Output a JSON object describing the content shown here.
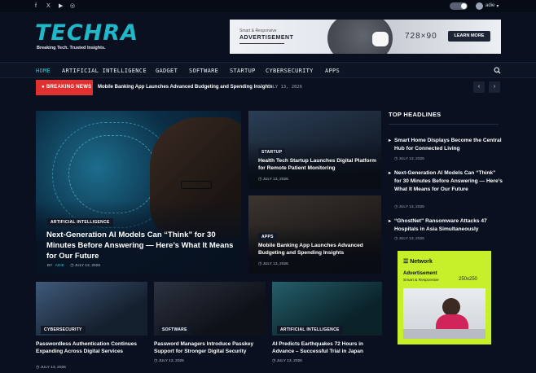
{
  "topbar": {
    "social_icons": [
      "facebook-icon",
      "x-icon",
      "youtube-icon",
      "instagram-icon"
    ],
    "social_glyphs": [
      "f",
      "X",
      "▶",
      "◎"
    ],
    "user_name": "adie",
    "user_caret": "▾"
  },
  "header": {
    "logo": "TECHRA",
    "tagline": "Breaking Tech. Trusted Insights.",
    "ad": {
      "small": "Smart & Responsive",
      "title": "ADVERTISEMENT",
      "size": "728×90",
      "button": "LEARN MORE"
    }
  },
  "nav": {
    "items": [
      "HOME",
      "ARTIFICIAL INTELLIGENCE",
      "GADGET",
      "SOFTWARE",
      "STARTUP",
      "CYBERSECURITY",
      "APPS"
    ],
    "active_index": 0
  },
  "breaking": {
    "label": "BREAKING NEWS",
    "headline": "Mobile Banking App Launches Advanced Budgeting and Spending Insights",
    "date": "JULY 13, 2026",
    "prev": "‹",
    "next": "›"
  },
  "featured": {
    "category": "ARTIFICIAL INTELLIGENCE",
    "title": "Next-Generation AI Models Can “Think” for 30 Minutes Before Answering — Here’s What It Means for Our Future",
    "by": "BY",
    "author": "ADIE",
    "date": "JULY 13, 2026"
  },
  "side_cards": [
    {
      "category": "STARTUP",
      "title": "Health Tech Startup Launches Digital Platform for Remote Patient Monitoring",
      "date": "JULY 13, 2026"
    },
    {
      "category": "APPS",
      "title": "Mobile Banking App Launches Advanced Budgeting and Spending Insights",
      "date": "JULY 13, 2026"
    }
  ],
  "bottom_cards": [
    {
      "category": "CYBERSECURITY",
      "title": "Passwordless Authentication Continues Expanding Across Digital Services",
      "date": "JULY 13, 2026"
    },
    {
      "category": "SOFTWARE",
      "title": "Password Managers Introduce Passkey Support for Stronger Digital Security",
      "date": "JULY 13, 2026"
    },
    {
      "category": "ARTIFICIAL INTELLIGENCE",
      "title": "AI Predicts Earthquakes 72 Hours in Advance – Successful Trial in Japan",
      "date": "JULY 13, 2026"
    }
  ],
  "sidebar": {
    "heading": "TOP HEADLINES",
    "items": [
      {
        "title": "Smart Home Displays Become the Central Hub for Connected Living",
        "date": "JULY 13, 2026"
      },
      {
        "title": "Next-Generation AI Models Can “Think” for 30 Minutes Before Answering — Here’s What It Means for Our Future",
        "date": "JULY 13, 2026"
      },
      {
        "title": "“GhostNet” Ransomware Attacks 47 Hospitals in Asia Simultaneously",
        "date": "JULY 13, 2026"
      }
    ],
    "ad": {
      "brand": "Network",
      "title": "Advertisement",
      "subtitle": "Smart & Responsive",
      "size": "250x250"
    }
  },
  "colors": {
    "accent": "#2ec5d6",
    "breaking": "#e03131",
    "background": "#0a1020",
    "ad_green": "#c8f02a"
  }
}
